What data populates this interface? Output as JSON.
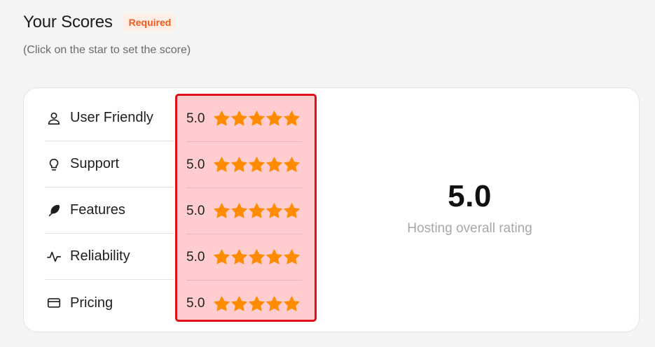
{
  "header": {
    "title": "Your Scores",
    "badge": "Required",
    "subtitle": "(Click on the star to set the score)"
  },
  "categories": [
    {
      "label": "User Friendly",
      "icon": "user-icon",
      "score": "5.0",
      "stars": 5
    },
    {
      "label": "Support",
      "icon": "lightbulb-icon",
      "score": "5.0",
      "stars": 5
    },
    {
      "label": "Features",
      "icon": "feather-icon",
      "score": "5.0",
      "stars": 5
    },
    {
      "label": "Reliability",
      "icon": "activity-icon",
      "score": "5.0",
      "stars": 5
    },
    {
      "label": "Pricing",
      "icon": "credit-card-icon",
      "score": "5.0",
      "stars": 5
    }
  ],
  "overall": {
    "value": "5.0",
    "label": "Hosting overall rating"
  },
  "colors": {
    "star": "#ff8c00",
    "badge_text": "#f25a1c",
    "highlight_border": "#e0101a",
    "highlight_fill": "#ffcdcf"
  }
}
